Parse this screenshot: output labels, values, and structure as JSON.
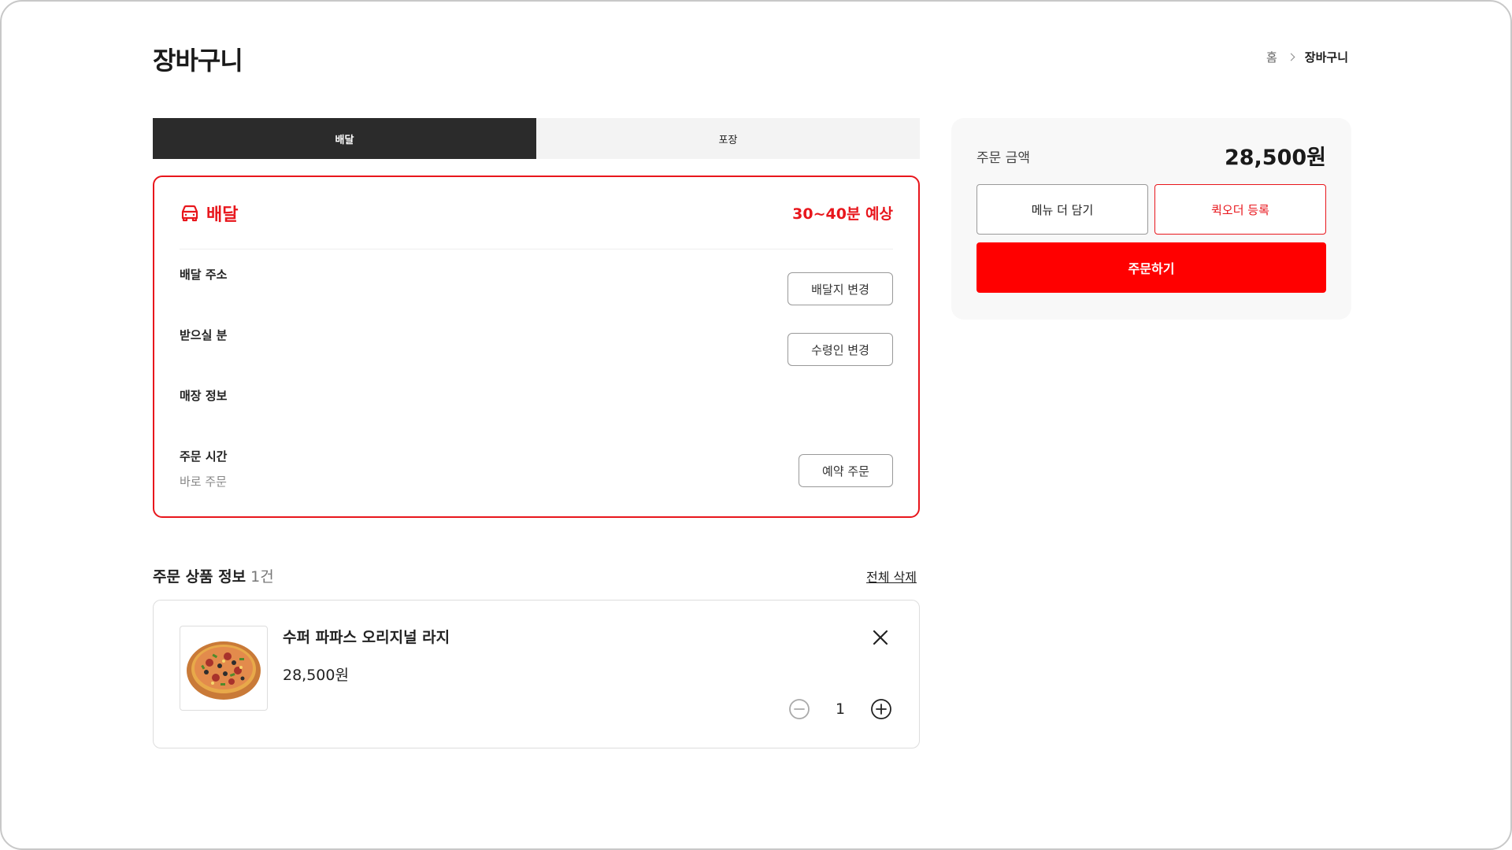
{
  "page": {
    "title": "장바구니"
  },
  "breadcrumb": {
    "home": "홈",
    "current": "장바구니"
  },
  "tabs": [
    {
      "label": "배달",
      "active": true
    },
    {
      "label": "포장",
      "active": false
    }
  ],
  "delivery": {
    "title": "배달",
    "eta": "30~40분 예상",
    "icon": "car-icon",
    "address": {
      "label": "배달 주소",
      "button": "배달지 변경"
    },
    "recipient": {
      "label": "받으실 분",
      "button": "수령인 변경"
    },
    "store": {
      "label": "매장 정보"
    },
    "order_time": {
      "label": "주문 시간",
      "value": "바로 주문",
      "button": "예약 주문"
    }
  },
  "items_section": {
    "title": "주문 상품 정보",
    "count": "1건",
    "delete_all": "전체 삭제",
    "items": [
      {
        "name": "수퍼 파파스 오리지널 라지",
        "price": "28,500원",
        "quantity": "1",
        "image": "pizza-image"
      }
    ]
  },
  "summary": {
    "label": "주문 금액",
    "amount": "28,500원",
    "more_menu": "메뉴 더 담기",
    "quick_order": "퀵오더 등록",
    "order": "주문하기"
  },
  "colors": {
    "accent": "#e8161c",
    "order_button": "#ff0000",
    "tab_active": "#2b2b2b"
  }
}
